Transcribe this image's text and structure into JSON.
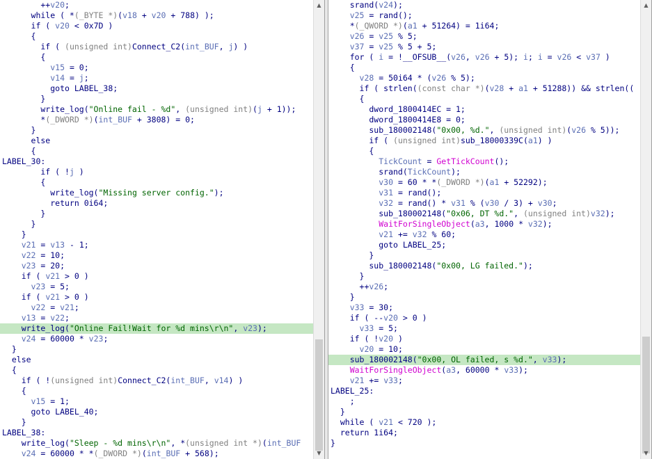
{
  "left_pane": {
    "lines": [
      {
        "t": "        ++v20;"
      },
      {
        "t": "      while ( *(_BYTE *)(v18 + v20 + 788) );"
      },
      {
        "t": "      if ( v20 < 0x7D )"
      },
      {
        "t": "      {"
      },
      {
        "t": "        if ( (unsigned int)Connect_C2(int_BUF, j) )"
      },
      {
        "t": "        {"
      },
      {
        "t": "          v15 = 0;"
      },
      {
        "t": "          v14 = j;"
      },
      {
        "t": "          goto LABEL_38;"
      },
      {
        "t": "        }"
      },
      {
        "t": "        write_log(\"Online fail - %d\", (unsigned int)(j + 1));"
      },
      {
        "t": "        *(_DWORD *)(int_BUF + 3808) = 0;"
      },
      {
        "t": "      }"
      },
      {
        "t": "      else"
      },
      {
        "t": "      {"
      },
      {
        "t": "LABEL_30:"
      },
      {
        "t": "        if ( !j )"
      },
      {
        "t": "        {"
      },
      {
        "t": "          write_log(\"Missing server config.\");"
      },
      {
        "t": "          return 0i64;"
      },
      {
        "t": "        }"
      },
      {
        "t": "      }"
      },
      {
        "t": "    }"
      },
      {
        "t": "    v21 = v13 - 1;"
      },
      {
        "t": "    v22 = 10;"
      },
      {
        "t": "    v23 = 20;"
      },
      {
        "t": "    if ( v21 > 0 )"
      },
      {
        "t": "      v23 = 5;"
      },
      {
        "t": "    if ( v21 > 0 )"
      },
      {
        "t": "      v22 = v21;"
      },
      {
        "t": "    v13 = v22;"
      },
      {
        "t": "    write_log(\"Online Fail!Wait for %d mins\\r\\n\", v23);",
        "hl": true
      },
      {
        "t": "    v24 = 60000 * v23;"
      },
      {
        "t": "  }"
      },
      {
        "t": "  else"
      },
      {
        "t": "  {"
      },
      {
        "t": "    if ( !(unsigned int)Connect_C2(int_BUF, v14) )"
      },
      {
        "t": "    {"
      },
      {
        "t": "      v15 = 1;"
      },
      {
        "t": "      goto LABEL_40;"
      },
      {
        "t": "    }"
      },
      {
        "t": "LABEL_38:"
      },
      {
        "t": "    write_log(\"Sleep - %d mins\\r\\n\", *(unsigned int *)(int_BUF"
      },
      {
        "t": "    v24 = 60000 * *(_DWORD *)(int_BUF + 568);"
      }
    ]
  },
  "right_pane": {
    "lines": [
      {
        "t": "    srand(v24);"
      },
      {
        "t": "    v25 = rand();"
      },
      {
        "t": "    *(_QWORD *)(a1 + 51264) = 1i64;"
      },
      {
        "t": "    v26 = v25 % 5;"
      },
      {
        "t": "    v37 = v25 % 5 + 5;"
      },
      {
        "t": "    for ( i = !__OFSUB__(v26, v26 + 5); i; i = v26 < v37 )"
      },
      {
        "t": "    {"
      },
      {
        "t": "      v28 = 50i64 * (v26 % 5);"
      },
      {
        "t": "      if ( strlen((const char *)(v28 + a1 + 51288)) && strlen(("
      },
      {
        "t": "      {"
      },
      {
        "t": "        dword_1800414EC = 1;"
      },
      {
        "t": "        dword_1800414E8 = 0;"
      },
      {
        "t": "        sub_180002148(\"0x00, %d.\", (unsigned int)(v26 % 5));"
      },
      {
        "t": "        if ( (unsigned int)sub_18000339C(a1) )"
      },
      {
        "t": "        {"
      },
      {
        "t": "          TickCount = GetTickCount();"
      },
      {
        "t": "          srand(TickCount);"
      },
      {
        "t": "          v30 = 60 * *(_DWORD *)(a1 + 52292);"
      },
      {
        "t": "          v31 = rand();"
      },
      {
        "t": "          v32 = rand() * v31 % (v30 / 3) + v30;"
      },
      {
        "t": "          sub_180002148(\"0x06, DT %d.\", (unsigned int)v32);"
      },
      {
        "t": "          WaitForSingleObject(a3, 1000 * v32);"
      },
      {
        "t": "          v21 += v32 % 60;"
      },
      {
        "t": "          goto LABEL_25;"
      },
      {
        "t": "        }"
      },
      {
        "t": "        sub_180002148(\"0x00, LG failed.\");"
      },
      {
        "t": "      }"
      },
      {
        "t": "      ++v26;"
      },
      {
        "t": "    }"
      },
      {
        "t": "    v33 = 30;"
      },
      {
        "t": "    if ( --v20 > 0 )"
      },
      {
        "t": "      v33 = 5;"
      },
      {
        "t": "    if ( !v20 )"
      },
      {
        "t": "      v20 = 10;"
      },
      {
        "t": "    sub_180002148(\"0x00, OL failed, s %d.\", v33);",
        "hl": true
      },
      {
        "t": "    WaitForSingleObject(a3, 60000 * v33);"
      },
      {
        "t": "    v21 += v33;"
      },
      {
        "t": "LABEL_25:"
      },
      {
        "t": "    ;"
      },
      {
        "t": "  }"
      },
      {
        "t": "  while ( v21 < 720 );"
      },
      {
        "t": "  return 1i64;"
      },
      {
        "t": "}"
      }
    ]
  },
  "scrollbar": {
    "up_glyph": "▲",
    "down_glyph": "▼"
  },
  "colors": {
    "keyword": "#000080",
    "variable": "#5a6eb4",
    "string": "#006400",
    "type_cast": "#808080",
    "api": "#d000d0",
    "highlight": "#c5e7c3"
  }
}
